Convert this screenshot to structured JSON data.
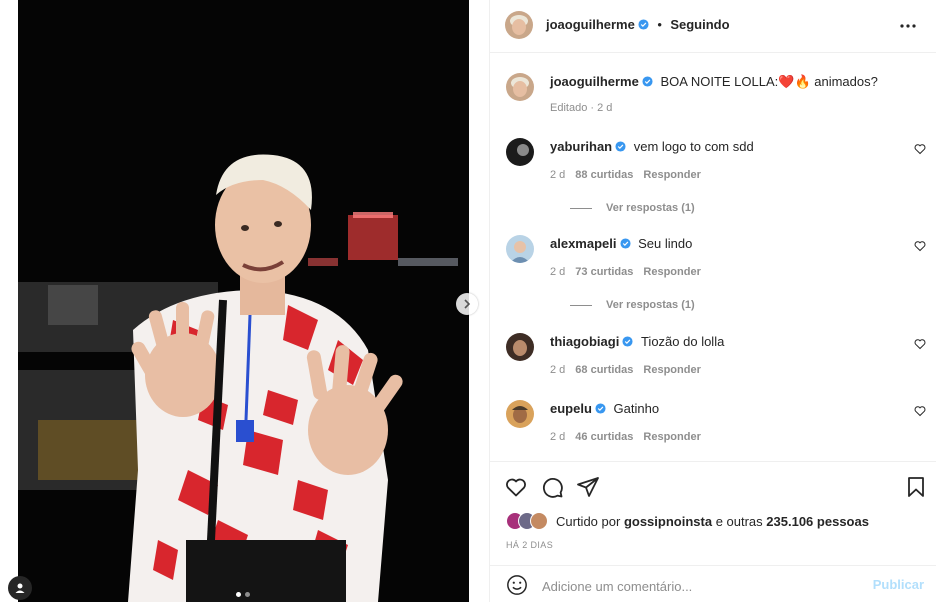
{
  "post": {
    "author": "joaoguilherme",
    "follow_status": "Seguindo",
    "follow_separator": "•",
    "caption_text": "BOA NOITE LOLLA:❤️🔥 animados?",
    "caption_meta": "Editado · 2 d",
    "media": {
      "carousel_index": 1,
      "carousel_total": 2
    }
  },
  "comments": [
    {
      "user": "yaburihan",
      "text": "vem logo to com sdd",
      "time": "2 d",
      "likes": "88 curtidas",
      "reply": "Responder",
      "view_replies": "Ver respostas (1)"
    },
    {
      "user": "alexmapeli",
      "text": "Seu lindo",
      "time": "2 d",
      "likes": "73 curtidas",
      "reply": "Responder",
      "view_replies": "Ver respostas (1)"
    },
    {
      "user": "thiagobiagi",
      "text": "Tiozão do lolla",
      "time": "2 d",
      "likes": "68 curtidas",
      "reply": "Responder"
    },
    {
      "user": "eupelu",
      "text": "Gatinho",
      "time": "2 d",
      "likes": "46 curtidas",
      "reply": "Responder"
    }
  ],
  "likes": {
    "prefix": "Curtido por",
    "user": "gossipnoinsta",
    "and_others": "e outras",
    "count": "235.106",
    "suffix": "pessoas"
  },
  "date_label": "HÁ 2 DIAS",
  "add_comment": {
    "placeholder": "Adicione um comentário...",
    "post_label": "Publicar"
  },
  "colors": {
    "verified": "#3897f0",
    "heart": "#ed4956",
    "text": "#262626",
    "muted": "#8e8e8e",
    "post_disabled": "#b2dffc"
  }
}
